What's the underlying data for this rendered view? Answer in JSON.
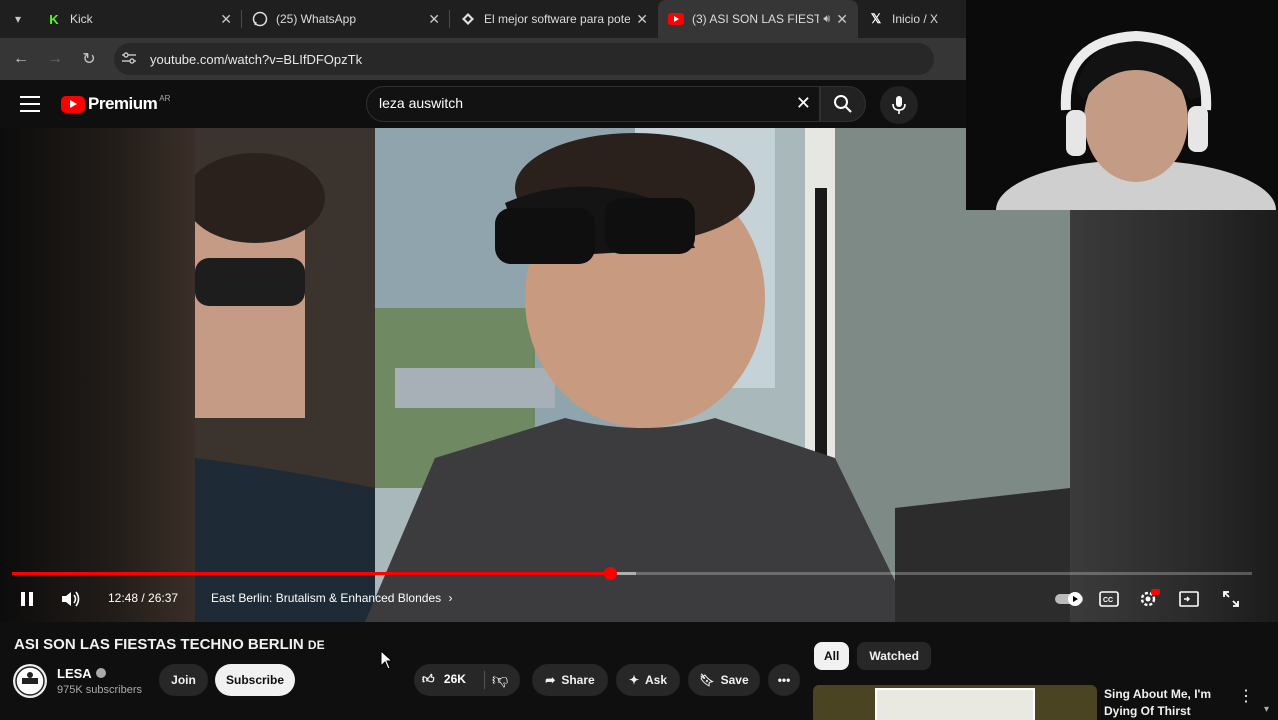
{
  "browser": {
    "tabs": [
      {
        "title": "Kick",
        "icon": "kick-icon",
        "active": false
      },
      {
        "title": "(25) WhatsApp",
        "icon": "whatsapp-icon",
        "active": false
      },
      {
        "title": "El mejor software para poter",
        "icon": "diamond-icon",
        "active": false
      },
      {
        "title": "(3) ASI SON LAS FIESTAS",
        "icon": "youtube-icon",
        "active": true,
        "audio": true
      },
      {
        "title": "Inicio / X",
        "icon": "x-icon",
        "active": false
      }
    ],
    "url": "youtube.com/watch?v=BLIfDFOpzTk"
  },
  "youtube": {
    "logo_text": "Premium",
    "country": "AR",
    "search_query": "leza auswitch"
  },
  "player": {
    "time_label": "12:48 / 26:37",
    "chapter": "East Berlin: Brutalism & Enhanced Blondes",
    "progress_fraction": 0.482,
    "buffer_fraction": 0.503
  },
  "video": {
    "title": "ASI SON LAS FIESTAS TECHNO BERLIN",
    "title_suffix": "DE",
    "channel": "LESA",
    "subscribers": "975K subscribers",
    "join_label": "Join",
    "subscribe_label": "Subscribe",
    "likes": "26K",
    "share_label": "Share",
    "ask_label": "Ask",
    "save_label": "Save"
  },
  "recommendations": {
    "chips": [
      "All",
      "Watched"
    ],
    "first_title": "Sing About Me, I'm Dying Of Thirst"
  },
  "colors": {
    "accent": "#ff0000",
    "background": "#0f0f0f"
  }
}
